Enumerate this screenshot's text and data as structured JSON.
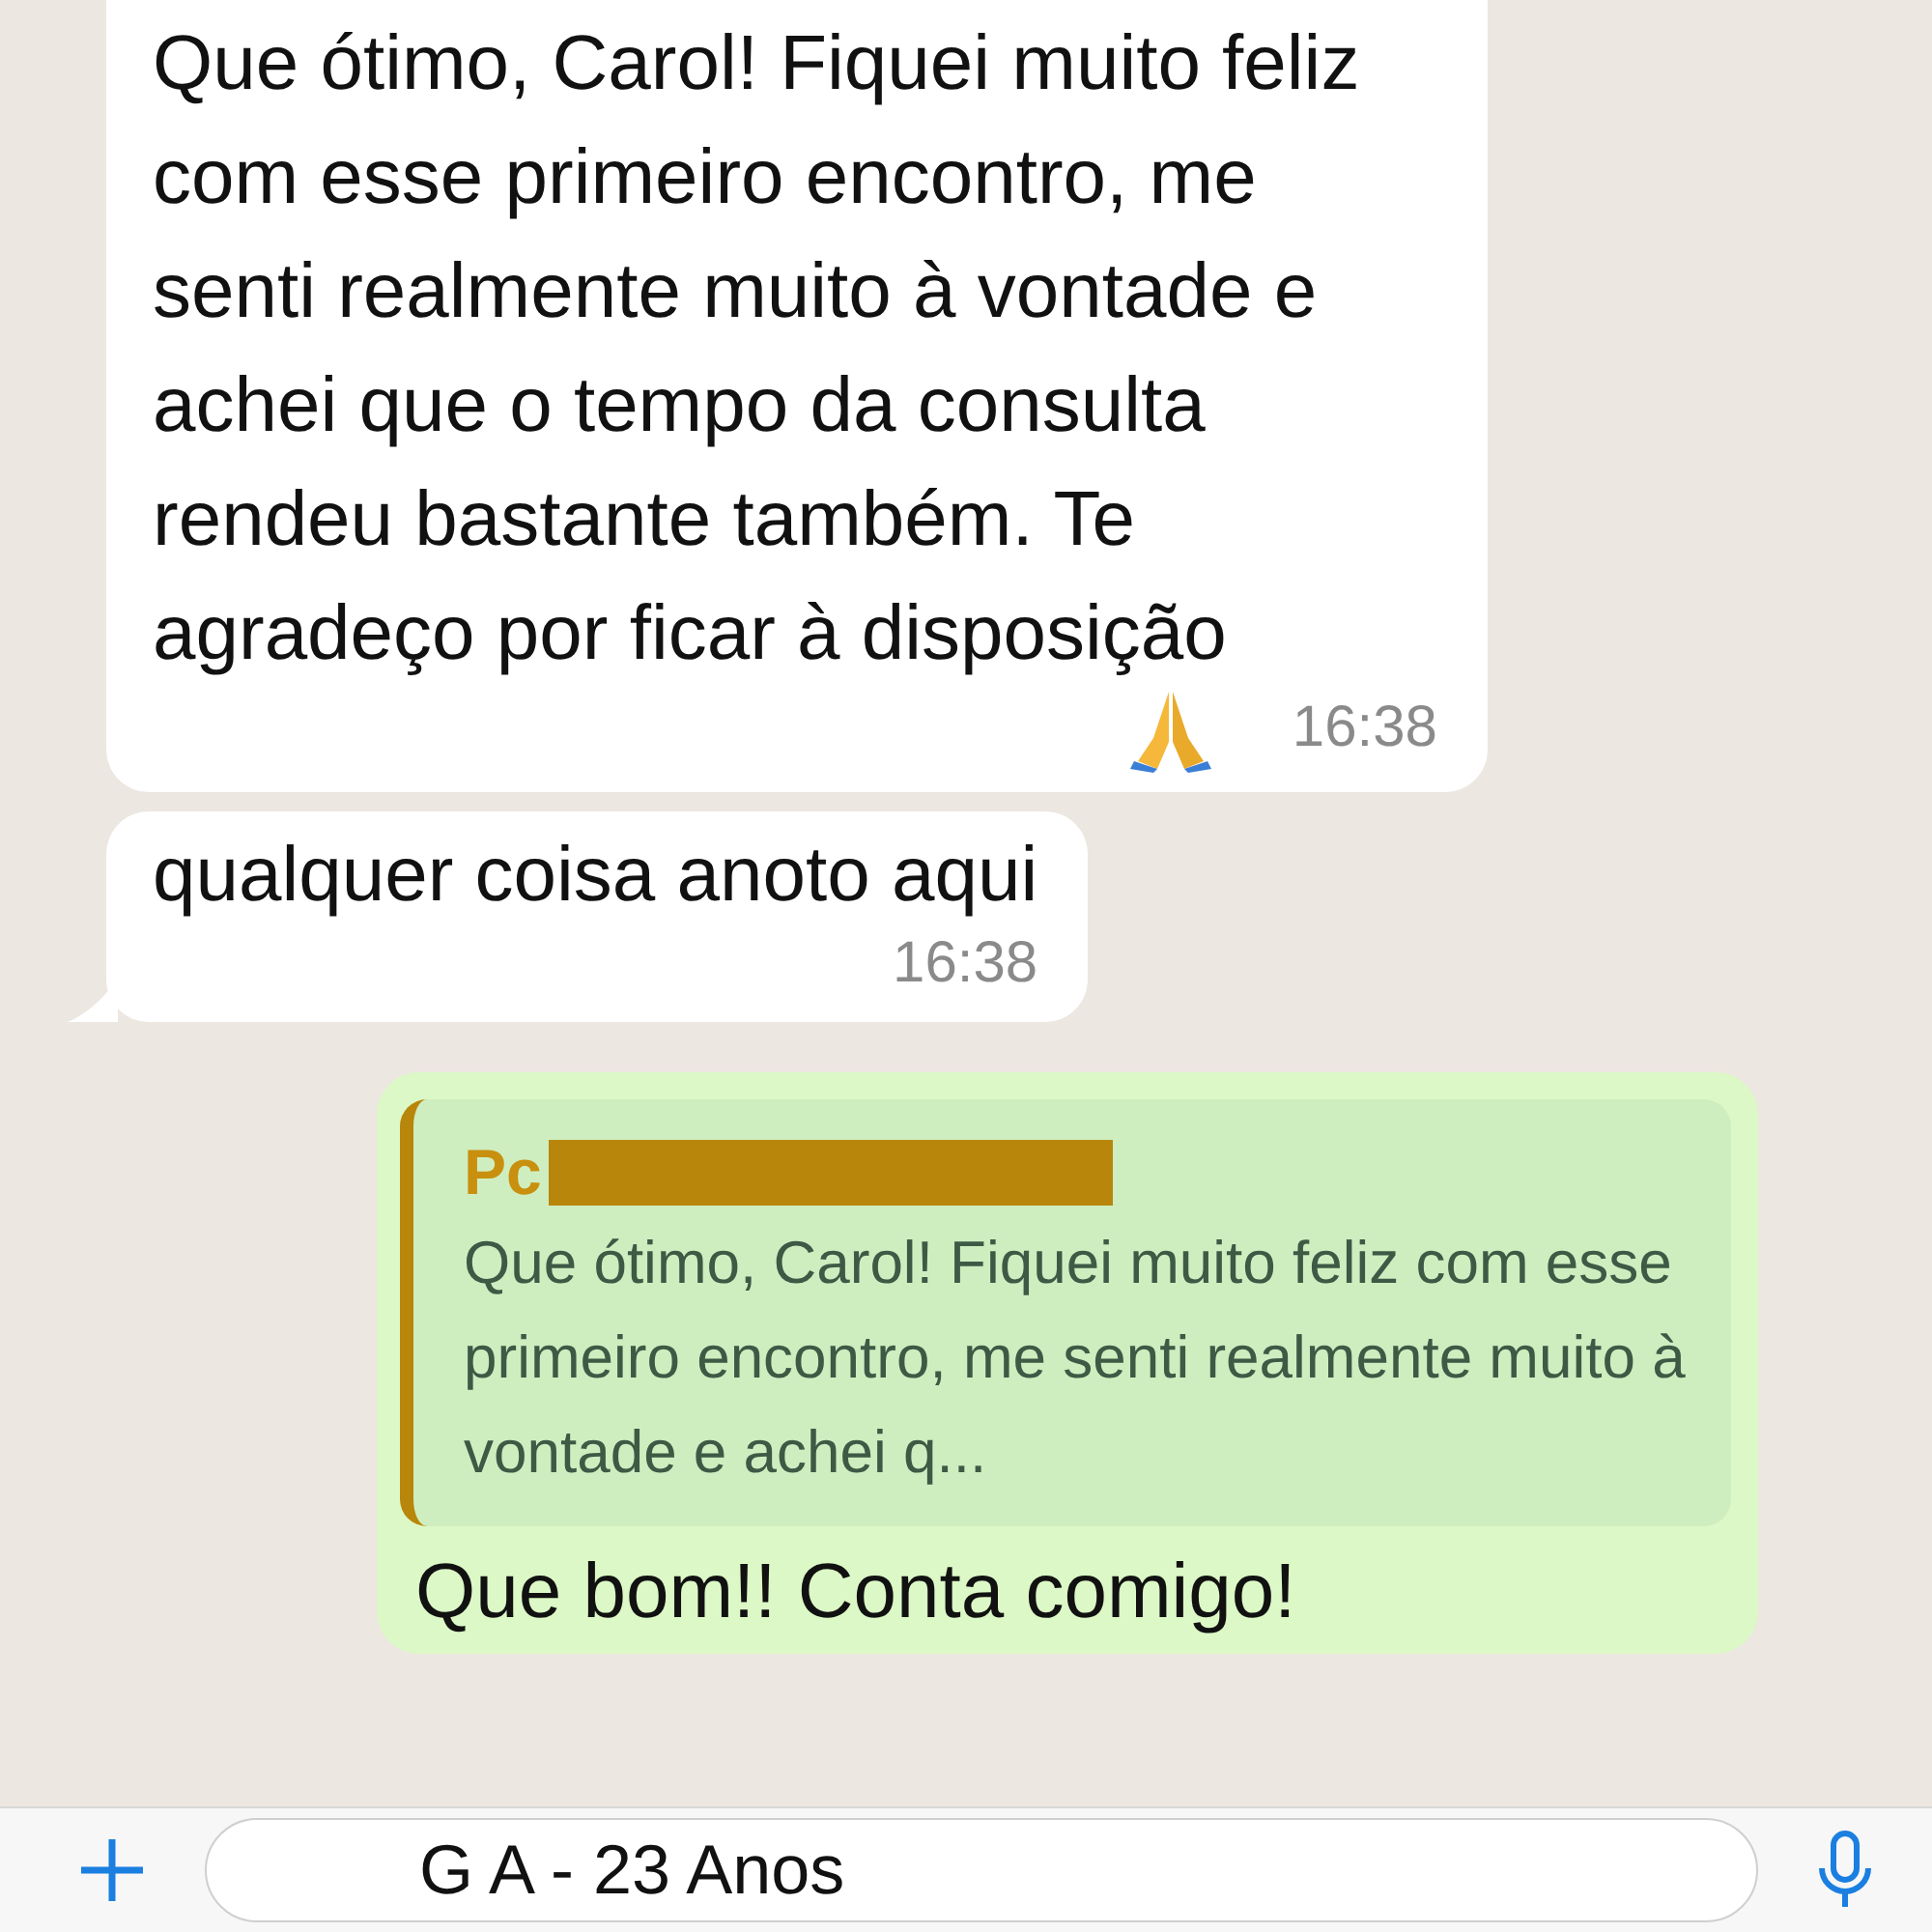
{
  "messages": [
    {
      "kind": "incoming",
      "text": "Que ótimo, Carol! Fiquei muito feliz com esse primeiro encontro, me senti realmente muito à vontade e achei que o tempo da consulta rendeu bastante também. Te agradeço por ficar à disposição",
      "emoji": true,
      "time": "16:38",
      "tail": false
    },
    {
      "kind": "incoming",
      "text": "qualquer coisa anoto aqui",
      "emoji": false,
      "time": "16:38",
      "tail": true
    },
    {
      "kind": "outgoing",
      "quote": {
        "author": "Pc",
        "author_redacted": true,
        "text": "Que ótimo, Carol! Fiquei muito feliz com esse primeiro encontro, me senti realmente muito à vontade e achei q..."
      },
      "text": "Que bom!! Conta comigo!"
    }
  ],
  "input_bar": {
    "value": "G A - 23 Anos"
  }
}
